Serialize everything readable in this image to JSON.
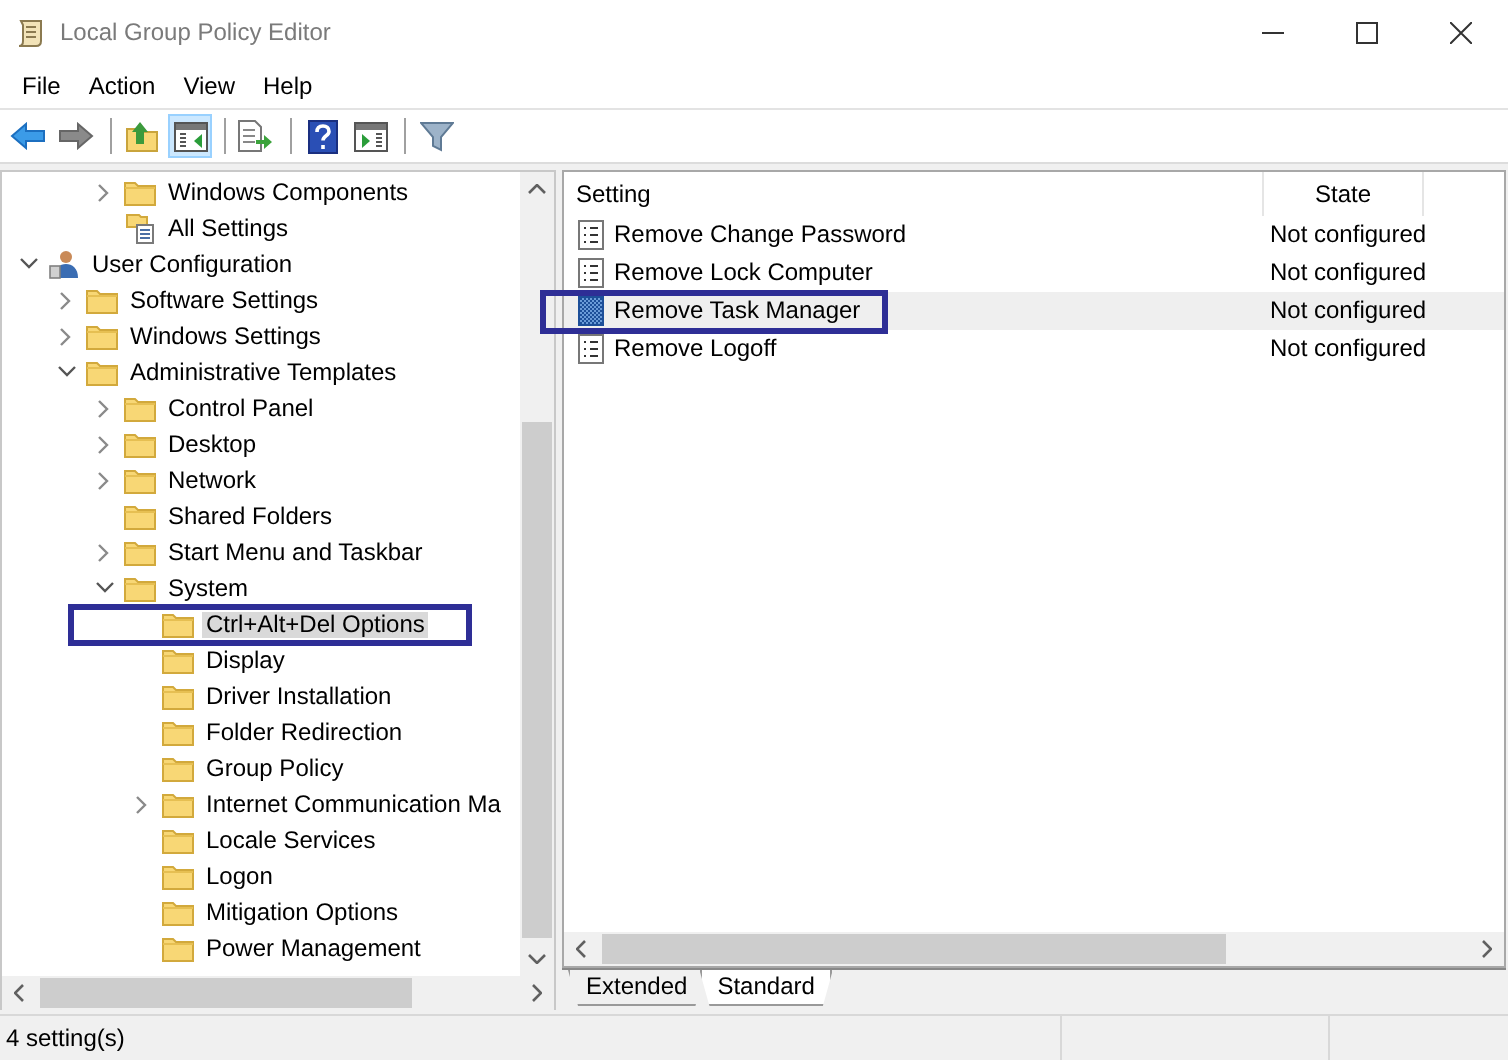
{
  "window": {
    "title": "Local Group Policy Editor"
  },
  "menu": [
    "File",
    "Action",
    "View",
    "Help"
  ],
  "toolbar": [
    {
      "kind": "back",
      "pressed": false
    },
    {
      "kind": "forward",
      "pressed": false
    },
    {
      "kind": "separator"
    },
    {
      "kind": "up",
      "pressed": false
    },
    {
      "kind": "tree-toggle",
      "pressed": true
    },
    {
      "kind": "separator"
    },
    {
      "kind": "export",
      "pressed": false
    },
    {
      "kind": "separator"
    },
    {
      "kind": "help",
      "pressed": false
    },
    {
      "kind": "action-pane",
      "pressed": false
    },
    {
      "kind": "separator"
    },
    {
      "kind": "filter",
      "pressed": false
    }
  ],
  "tree_partial": [
    {
      "label": "Windows Components",
      "kind": "folder",
      "expanded": false,
      "selected": false,
      "highlighted": false
    },
    {
      "label": "All Settings",
      "kind": "settings",
      "selected": false,
      "highlighted": false
    }
  ],
  "tree": [
    {
      "label": "User Configuration",
      "kind": "user",
      "expanded": true,
      "selected": false,
      "highlighted": false,
      "children": [
        {
          "label": "Software Settings",
          "kind": "folder",
          "expanded": false,
          "selected": false,
          "highlighted": false
        },
        {
          "label": "Windows Settings",
          "kind": "folder",
          "expanded": false,
          "selected": false,
          "highlighted": false
        },
        {
          "label": "Administrative Templates",
          "kind": "folder",
          "expanded": true,
          "selected": false,
          "highlighted": false,
          "children": [
            {
              "label": "Control Panel",
              "kind": "folder",
              "expanded": false,
              "selected": false,
              "highlighted": false
            },
            {
              "label": "Desktop",
              "kind": "folder",
              "expanded": false,
              "selected": false,
              "highlighted": false
            },
            {
              "label": "Network",
              "kind": "folder",
              "expanded": false,
              "selected": false,
              "highlighted": false
            },
            {
              "label": "Shared Folders",
              "kind": "folder",
              "selected": false,
              "highlighted": false
            },
            {
              "label": "Start Menu and Taskbar",
              "kind": "folder",
              "expanded": false,
              "selected": false,
              "highlighted": false
            },
            {
              "label": "System",
              "kind": "folder",
              "expanded": true,
              "selected": false,
              "highlighted": false,
              "children": [
                {
                  "label": "Ctrl+Alt+Del Options",
                  "kind": "folder",
                  "selected": true,
                  "highlighted": true
                },
                {
                  "label": "Display",
                  "kind": "folder",
                  "selected": false,
                  "highlighted": false
                },
                {
                  "label": "Driver Installation",
                  "kind": "folder",
                  "selected": false,
                  "highlighted": false
                },
                {
                  "label": "Folder Redirection",
                  "kind": "folder",
                  "selected": false,
                  "highlighted": false
                },
                {
                  "label": "Group Policy",
                  "kind": "folder",
                  "selected": false,
                  "highlighted": false
                },
                {
                  "label": "Internet Communication Ma",
                  "kind": "folder",
                  "expanded": false,
                  "selected": false,
                  "highlighted": false
                },
                {
                  "label": "Locale Services",
                  "kind": "folder",
                  "selected": false,
                  "highlighted": false
                },
                {
                  "label": "Logon",
                  "kind": "folder",
                  "selected": false,
                  "highlighted": false
                },
                {
                  "label": "Mitigation Options",
                  "kind": "folder",
                  "selected": false,
                  "highlighted": false
                },
                {
                  "label": "Power Management",
                  "kind": "folder",
                  "selected": false,
                  "highlighted": false
                }
              ]
            }
          ]
        }
      ]
    }
  ],
  "table": {
    "columns": [
      "Setting",
      "State"
    ],
    "rows": [
      {
        "setting": "Remove Change Password",
        "state": "Not configured",
        "selected": false,
        "highlighted": false
      },
      {
        "setting": "Remove Lock Computer",
        "state": "Not configured",
        "selected": false,
        "highlighted": false
      },
      {
        "setting": "Remove Task Manager",
        "state": "Not configured",
        "selected": true,
        "highlighted": true
      },
      {
        "setting": "Remove Logoff",
        "state": "Not configured",
        "selected": false,
        "highlighted": false
      }
    ]
  },
  "tabs": [
    {
      "label": "Extended",
      "selected": false
    },
    {
      "label": "Standard",
      "selected": true
    }
  ],
  "status_bar": "4 setting(s)"
}
